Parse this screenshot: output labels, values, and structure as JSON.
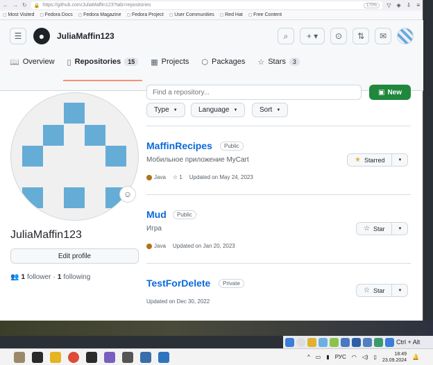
{
  "browser": {
    "url": "https://github.com/JuliaMaffin123?tab=repositories",
    "zoom": "170%",
    "bookmarks": [
      "Most Visited",
      "Fedora Docs",
      "Fedora Magazine",
      "Fedora Project",
      "User Communities",
      "Red Hat",
      "Free Content"
    ]
  },
  "header": {
    "username": "JuliaMaffin123"
  },
  "tabs": [
    {
      "label": "Overview",
      "icon": "book-icon"
    },
    {
      "label": "Repositories",
      "icon": "repo-icon",
      "count": "15"
    },
    {
      "label": "Projects",
      "icon": "table-icon"
    },
    {
      "label": "Packages",
      "icon": "package-icon"
    },
    {
      "label": "Stars",
      "icon": "star-icon",
      "count": "3"
    }
  ],
  "profile": {
    "name": "JuliaMaffin123",
    "edit_label": "Edit profile",
    "followers_count": "1",
    "followers_label": "follower",
    "separator": "·",
    "following_count": "1",
    "following_label": "following"
  },
  "repo_toolbar": {
    "search_placeholder": "Find a repository...",
    "new_label": "New",
    "filters": [
      "Type",
      "Language",
      "Sort"
    ]
  },
  "repos": [
    {
      "name": "MaffinRecipes",
      "visibility": "Public",
      "description": "Мобильное приложение MyCart",
      "language": "Java",
      "stars": "1",
      "updated": "Updated on May 24, 2023",
      "star_label": "Starred",
      "starred": true
    },
    {
      "name": "Mud",
      "visibility": "Public",
      "description": "Игра",
      "language": "Java",
      "stars": "",
      "updated": "Updated on Jan 20, 2023",
      "star_label": "Star",
      "starred": false
    },
    {
      "name": "TestForDelete",
      "visibility": "Private",
      "description": "",
      "language": "",
      "stars": "",
      "updated": "Updated on Dec 30, 2022",
      "star_label": "Star",
      "starred": false
    }
  ],
  "system": {
    "tray_text": "Ctrl + Alt",
    "lang": "РУС",
    "time": "18:49",
    "date": "23.09.2024"
  },
  "colors": {
    "accent_green": "#1f883d",
    "link_blue": "#0969da",
    "java": "#b07219",
    "tab_underline": "#fd8c73"
  }
}
